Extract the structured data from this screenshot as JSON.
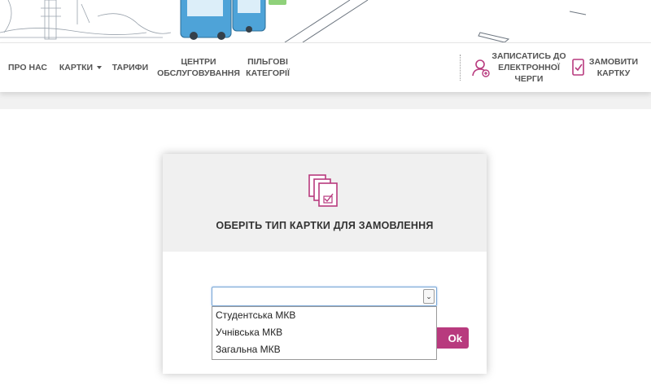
{
  "nav": {
    "items": [
      {
        "label": "ПРО НАС",
        "has_caret": false
      },
      {
        "label": "КАРТКИ",
        "has_caret": true
      },
      {
        "label": "ТАРИФИ",
        "has_caret": false
      },
      {
        "label": "ЦЕНТРИ ОБСЛУГОВУВАННЯ",
        "has_caret": false
      },
      {
        "label": "ПІЛЬГОВІ КАТЕГОРІЇ",
        "has_caret": false
      }
    ],
    "actions": [
      {
        "label": "ЗАПИСАТИСЬ ДО ЕЛЕКТРОННОЇ ЧЕРГИ",
        "icon": "user-add-icon"
      },
      {
        "label": "ЗАМОВИТИ КАРТКУ",
        "icon": "card-order-icon"
      }
    ]
  },
  "modal": {
    "icon": "documents-check-icon",
    "title": "ОБЕРІТЬ ТИП КАРТКИ ДЛЯ ЗАМОВЛЕННЯ",
    "select_value": "",
    "options": [
      "Студентська МКВ",
      "Учнівська МКВ",
      "Загальна МКВ"
    ],
    "ok_label": "Ok"
  },
  "colors": {
    "accent": "#b83a7e",
    "nav_text": "#555555",
    "modal_head_bg": "#f0f0f0"
  }
}
